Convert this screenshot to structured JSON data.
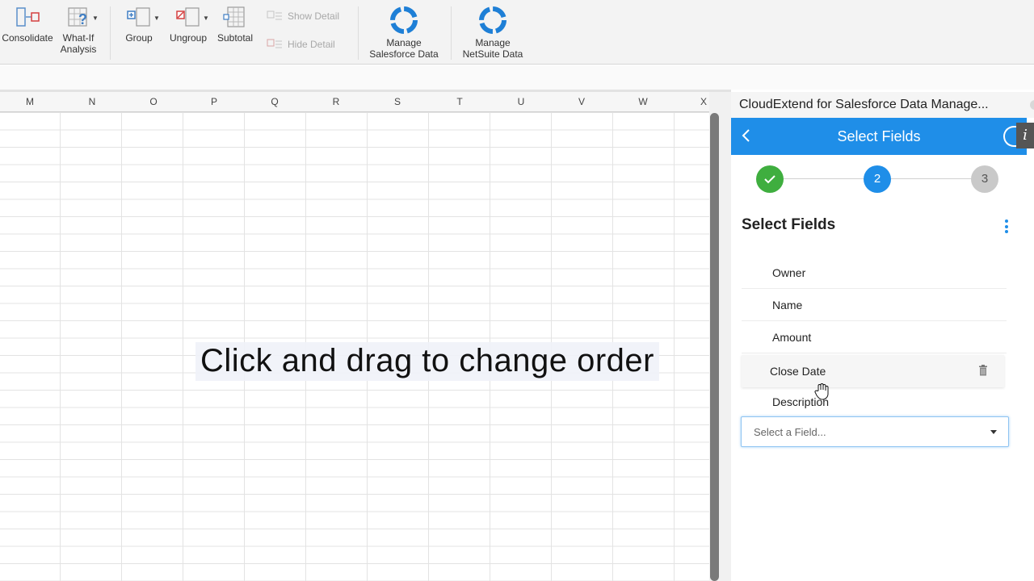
{
  "ribbon": {
    "consolidate": "Consolidate",
    "what_if": "What-If",
    "analysis": "Analysis",
    "group": "Group",
    "ungroup": "Ungroup",
    "subtotal": "Subtotal",
    "show_detail": "Show Detail",
    "hide_detail": "Hide Detail",
    "manage_sf_1": "Manage",
    "manage_sf_2": "Salesforce Data",
    "manage_ns_1": "Manage",
    "manage_ns_2": "NetSuite Data"
  },
  "columns": [
    "M",
    "N",
    "O",
    "P",
    "Q",
    "R",
    "S",
    "T",
    "U",
    "V",
    "W",
    "X"
  ],
  "caption": "Click and drag to change order",
  "panel": {
    "window_title": "CloudExtend for Salesforce Data Manage...",
    "header_title": "Select Fields",
    "info_label": "i",
    "steps": {
      "step2": "2",
      "step3": "3"
    },
    "section_title": "Select Fields",
    "fields": [
      "Owner",
      "Name",
      "Amount",
      "Close Date",
      "Description"
    ],
    "select_placeholder": "Select a Field..."
  },
  "colors": {
    "accent": "#1f8ee8",
    "success": "#3fae3f",
    "muted": "#c9c9c9"
  }
}
